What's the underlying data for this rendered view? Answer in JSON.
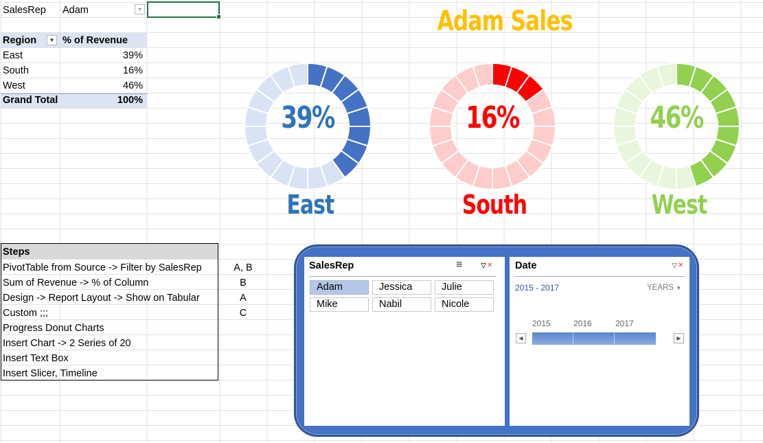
{
  "pivot": {
    "filter_field": "SalesRep",
    "filter_value": "Adam",
    "col_region": "Region",
    "col_pct": "% of Revenue",
    "rows": [
      {
        "region": "East",
        "pct": "39%"
      },
      {
        "region": "South",
        "pct": "16%"
      },
      {
        "region": "West",
        "pct": "46%"
      }
    ],
    "total_label": "Grand Total",
    "total_pct": "100%"
  },
  "title": "Adam Sales",
  "gauges": [
    {
      "region": "East",
      "value": 39,
      "label": "39%",
      "on": "#4472c4",
      "off": "#dae3f3",
      "text": "#2e75b6"
    },
    {
      "region": "South",
      "value": 16,
      "label": "16%",
      "on": "#ff0000",
      "off": "#ffcccc",
      "text": "#ff0000"
    },
    {
      "region": "West",
      "value": 46,
      "label": "46%",
      "on": "#92d050",
      "off": "#e9f5dc",
      "text": "#92d050"
    }
  ],
  "steps": {
    "header": "Steps",
    "items": [
      {
        "text": "PivotTable from Source -> Filter by SalesRep",
        "ref": "A, B"
      },
      {
        "text": "Sum of Revenue -> % of Column",
        "ref": "B"
      },
      {
        "text": "Design -> Report Layout -> Show on Tabular",
        "ref": "A"
      },
      {
        "text": "Custom ;;;",
        "ref": "C"
      },
      {
        "text": "Progress Donut Charts",
        "ref": ""
      },
      {
        "text": "Insert Chart -> 2 Series of 20",
        "ref": ""
      },
      {
        "text": "Insert Text Box",
        "ref": ""
      },
      {
        "text": "Insert Slicer, Timeline",
        "ref": ""
      }
    ]
  },
  "slicer": {
    "title": "SalesRep",
    "buttons": [
      "Adam",
      "Jessica",
      "Julie",
      "Mike",
      "Nabil",
      "Nicole"
    ],
    "selected": "Adam",
    "icons": [
      "multi-select-icon",
      "clear-filter-icon"
    ]
  },
  "timeline": {
    "title": "Date",
    "range": "2015 - 2017",
    "period": "YEARS",
    "years": [
      "2015",
      "2016",
      "2017"
    ],
    "icons": [
      "clear-filter-icon",
      "scroll-left-icon",
      "scroll-right-icon"
    ]
  }
}
